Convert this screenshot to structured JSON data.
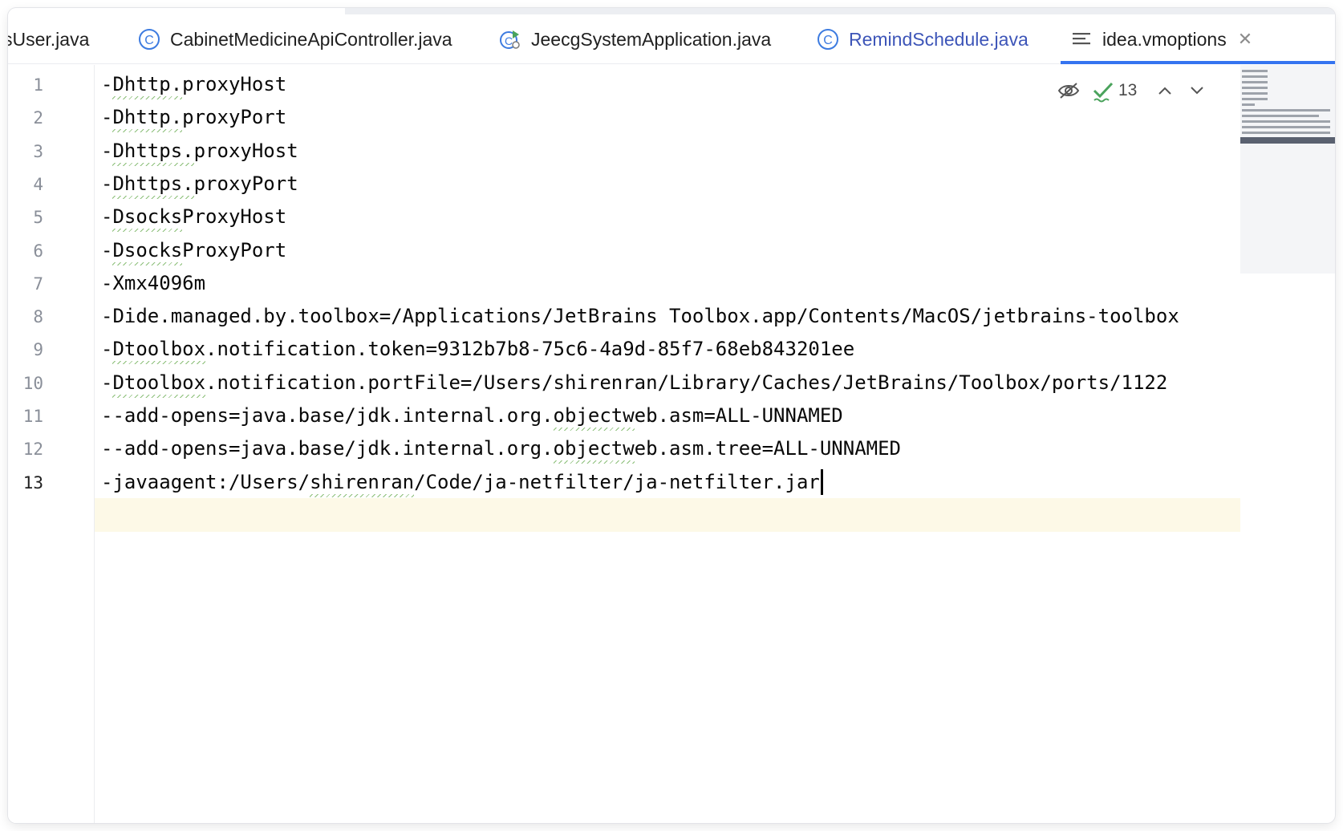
{
  "tabs": [
    {
      "label": "sysUser.java",
      "display": "sUser.java",
      "icon": "none"
    },
    {
      "label": "CabinetMedicineApiController.java",
      "icon": "java-class-icon"
    },
    {
      "label": "JeecgSystemApplication.java",
      "icon": "spring-boot-run-icon"
    },
    {
      "label": "RemindSchedule.java",
      "icon": "java-class-icon"
    },
    {
      "label": "idea.vmoptions",
      "icon": "text-file-icon",
      "active": true,
      "close": "✕"
    }
  ],
  "inspection": {
    "count": "13",
    "status": "passed"
  },
  "editor": {
    "current_line": 13,
    "lines": [
      {
        "n": "1",
        "text": "-Dhttp.proxyHost"
      },
      {
        "n": "2",
        "text": "-Dhttp.proxyPort"
      },
      {
        "n": "3",
        "text": "-Dhttps.proxyHost"
      },
      {
        "n": "4",
        "text": "-Dhttps.proxyPort"
      },
      {
        "n": "5",
        "text": "-DsocksProxyHost"
      },
      {
        "n": "6",
        "text": "-DsocksProxyPort"
      },
      {
        "n": "7",
        "text": "-Xmx4096m"
      },
      {
        "n": "8",
        "text": "-Dide.managed.by.toolbox=/Applications/JetBrains Toolbox.app/Contents/MacOS/jetbrains-toolbox"
      },
      {
        "n": "9",
        "text": "-Dtoolbox.notification.token=9312b7b8-75c6-4a9d-85f7-68eb843201ee"
      },
      {
        "n": "10",
        "text": "-Dtoolbox.notification.portFile=/Users/shirenran/Library/Caches/JetBrains/Toolbox/ports/1122"
      },
      {
        "n": "11",
        "text": "--add-opens=java.base/jdk.internal.org.objectweb.asm=ALL-UNNAMED"
      },
      {
        "n": "12",
        "text": "--add-opens=java.base/jdk.internal.org.objectweb.asm.tree=ALL-UNNAMED"
      },
      {
        "n": "13",
        "text": "-javaagent:/Users/shirenran/Code/ja-netfilter/ja-netfilter.jar"
      }
    ]
  },
  "colors": {
    "accent": "#3574f0",
    "current_line_bg": "#fdf9e7",
    "check_green": "#4aa35c",
    "class_icon": "#3d7be0"
  }
}
